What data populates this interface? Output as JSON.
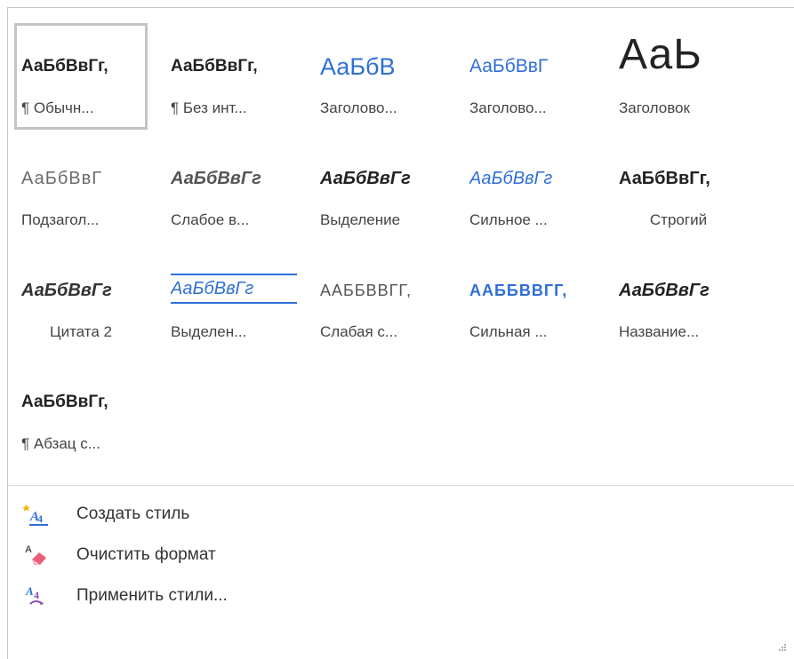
{
  "gallery": {
    "tiles": [
      {
        "preview": "АаБбВвГг,",
        "caption": "¶ Обычн...",
        "style": "s-normal",
        "selected": true,
        "align": "left"
      },
      {
        "preview": "АаБбВвГг,",
        "caption": "¶ Без инт...",
        "style": "s-normal",
        "selected": false,
        "align": "left"
      },
      {
        "preview": "АаБбВ",
        "caption": "Заголово...",
        "style": "s-heading1",
        "selected": false,
        "align": "left"
      },
      {
        "preview": "АаБбВвГ",
        "caption": "Заголово...",
        "style": "s-heading2",
        "selected": false,
        "align": "left"
      },
      {
        "preview": "АаЬ",
        "caption": "Заголовок",
        "style": "s-title",
        "selected": false,
        "align": "left"
      },
      {
        "preview": "АаБбВвГ",
        "caption": "Подзагол...",
        "style": "s-subtitle",
        "selected": false,
        "align": "left"
      },
      {
        "preview": "АаБбВвГг",
        "caption": "Слабое в...",
        "style": "s-subtle",
        "selected": false,
        "align": "left"
      },
      {
        "preview": "АаБбВвГг",
        "caption": "Выделение",
        "style": "s-emph",
        "selected": false,
        "align": "left"
      },
      {
        "preview": "АаБбВвГг",
        "caption": "Сильное ...",
        "style": "s-intense",
        "selected": false,
        "align": "left"
      },
      {
        "preview": "АаБбВвГг,",
        "caption": "Строгий",
        "style": "s-strong",
        "selected": false,
        "align": "center"
      },
      {
        "preview": "АаБбВвГг",
        "caption": "Цитата 2",
        "style": "s-quote",
        "selected": false,
        "align": "center"
      },
      {
        "preview": "АаБбВвГг",
        "caption": "Выделен...",
        "style": "s-iquote",
        "selected": false,
        "align": "left"
      },
      {
        "preview": "ААББВВГГ,",
        "caption": "Слабая с...",
        "style": "s-sref",
        "selected": false,
        "align": "left"
      },
      {
        "preview": "ААББВВГГ,",
        "caption": "Сильная ...",
        "style": "s-iref",
        "selected": false,
        "align": "left"
      },
      {
        "preview": "АаБбВвГг",
        "caption": "Название...",
        "style": "s-btitle",
        "selected": false,
        "align": "left"
      },
      {
        "preview": "АаБбВвГг,",
        "caption": "¶ Абзац с...",
        "style": "s-normal",
        "selected": false,
        "align": "left"
      }
    ]
  },
  "commands": [
    {
      "label": "Создать стиль",
      "icon": "new-style-icon"
    },
    {
      "label": "Очистить формат",
      "icon": "clear-formatting-icon"
    },
    {
      "label": "Применить стили...",
      "icon": "apply-styles-icon"
    }
  ],
  "colors": {
    "accent": "#2f6fd6",
    "selection_border": "#c4c4c4",
    "divider": "#d9d9d9"
  }
}
